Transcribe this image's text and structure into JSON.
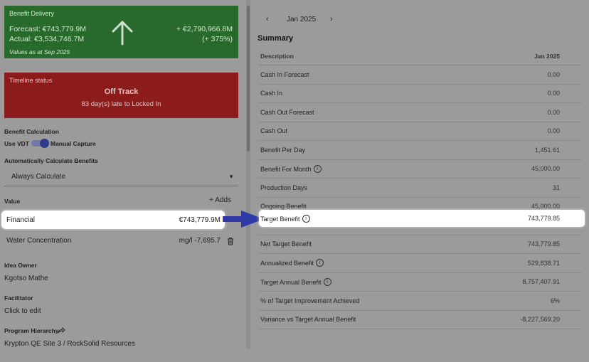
{
  "benefit_card": {
    "label": "Benefit Delivery",
    "forecast": "Forecast: €743,779.9M",
    "actual": "Actual: €3,534,746.7M",
    "values_as_at": "Values as at Sep 2025",
    "delta": "+ €2,790,966.8M",
    "delta_pct": "(+ 375%)",
    "color": "#276a2c"
  },
  "timeline_card": {
    "label": "Timeline status",
    "status": "Off Track",
    "detail": "83 day(s) late to Locked In",
    "color": "#8c1b1b"
  },
  "benefit_calc": {
    "heading": "Benefit Calculation",
    "toggle_left": "Use VDT",
    "toggle_right": "Manual Capture"
  },
  "auto_calc": {
    "heading": "Automatically Calculate Benefits",
    "selected": "Always Calculate"
  },
  "values_section": {
    "heading": "Value",
    "add_label": "+ Adds",
    "rows": [
      {
        "name": "Financial",
        "value": "€743,779.9M"
      },
      {
        "name": "Water Concentration",
        "value": "mg/l -7,695.7"
      }
    ]
  },
  "idea_owner": {
    "heading": "Idea Owner",
    "value": "Kgotso Mathe"
  },
  "facilitator": {
    "heading": "Facilitator",
    "value": "Click to edit"
  },
  "program": {
    "heading": "Program Hierarchy",
    "value": "Krypton QE Site 3 / RockSolid Resources"
  },
  "month_nav": {
    "prev": "‹",
    "month": "Jan 2025",
    "next": "›"
  },
  "summary": {
    "title": "Summary",
    "col_desc": "Description",
    "col_month": "Jan 2025",
    "rows": [
      {
        "desc": "Cash In Forecast",
        "value": "0.00"
      },
      {
        "desc": "Cash In",
        "value": "0.00"
      },
      {
        "desc": "Cash Out Forecast",
        "value": "0.00"
      },
      {
        "desc": "Cash Out",
        "value": "0.00"
      },
      {
        "desc": "Benefit Per Day",
        "value": "1,451.61"
      },
      {
        "desc": "Benefit For Month",
        "value": "45,000.00"
      },
      {
        "desc": "Production Days",
        "value": "31"
      },
      {
        "desc": "Ongoing Benefit",
        "value": "45,000.00"
      },
      {
        "desc": "Target Benefit",
        "value": "743,779.85"
      },
      {
        "desc": "Net Target Benefit",
        "value": "743,779.85"
      },
      {
        "desc": "Annualized Benefit",
        "value": "529,838.71"
      },
      {
        "desc": "Target Annual Benefit",
        "value": "8,757,407.91"
      },
      {
        "desc": "% of Target Improvement Achieved",
        "value": "6%"
      },
      {
        "desc": "Variance vs Target Annual Benefit",
        "value": "-8,227,569.20"
      }
    ]
  },
  "highlight_color": "#2f3aa8"
}
